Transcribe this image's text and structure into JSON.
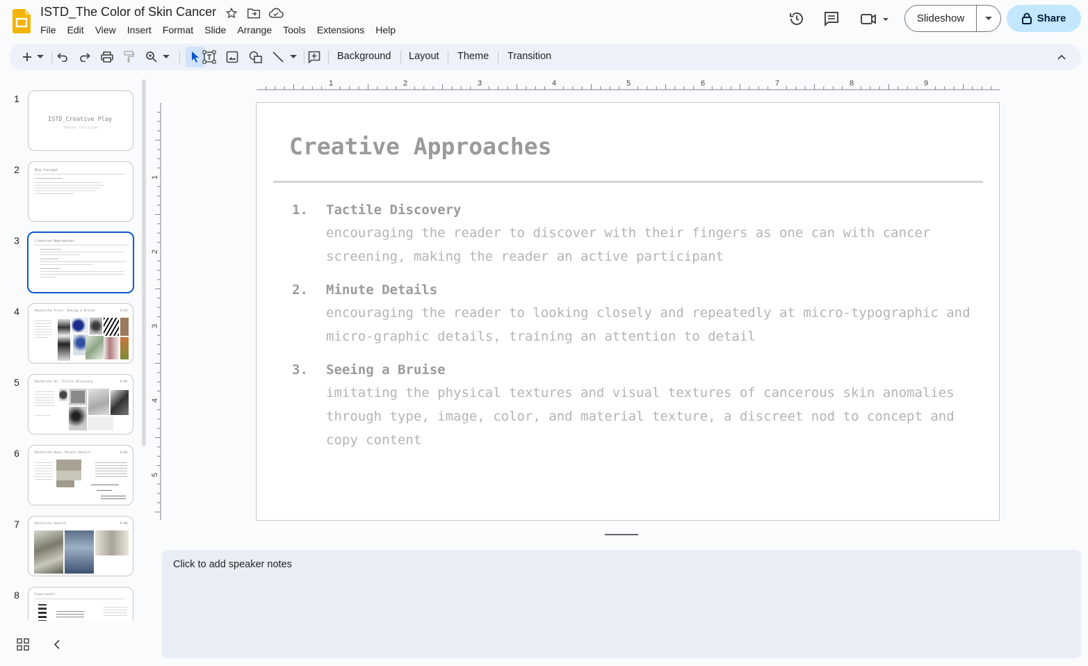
{
  "app": {
    "doc_title": "ISTD_The Color of Skin Cancer",
    "menu": [
      "File",
      "Edit",
      "View",
      "Insert",
      "Format",
      "Slide",
      "Arrange",
      "Tools",
      "Extensions",
      "Help"
    ],
    "slideshow_label": "Slideshow",
    "share_label": "Share",
    "accent_color": "#0b57d0",
    "share_bg": "#c2e7ff",
    "logo_color": "#f4b400"
  },
  "toolbar": {
    "background": "Background",
    "layout": "Layout",
    "theme": "Theme",
    "transition": "Transition"
  },
  "rulers": {
    "horizontal": [
      "1",
      "2",
      "3",
      "4",
      "5",
      "6",
      "7",
      "8",
      "9"
    ],
    "vertical": [
      "1",
      "2",
      "3",
      "4",
      "5"
    ]
  },
  "filmstrip": {
    "slides": [
      {
        "num": "1",
        "title": "ISTD_Creative Play",
        "subtitle": "Rachel Christian"
      },
      {
        "num": "2",
        "title": "Big Concept"
      },
      {
        "num": "3",
        "title": "Creative Approaches"
      },
      {
        "num": "4",
        "title": "Recherche Trois: Seeing a Bruise",
        "tag": "8–03"
      },
      {
        "num": "5",
        "title": "Recherche Un: Tactile Discovery",
        "tag": "8–05"
      },
      {
        "num": "6",
        "title": "Recherche Deux: Minute Details",
        "tag": "8–02"
      },
      {
        "num": "7",
        "title": "Recherche General",
        "tag": "8–00"
      },
      {
        "num": "8",
        "title": "Experiments"
      }
    ]
  },
  "slide": {
    "title": "Creative Approaches",
    "items": [
      {
        "num": "1.",
        "head": "Tactile Discovery",
        "body": "encouraging the reader to discover with their fingers as one can with cancer screening, making the reader an active participant"
      },
      {
        "num": "2.",
        "head": "Minute Details",
        "body": "encouraging the reader to looking closely and repeatedly at micro-typographic and micro-graphic details, training an attention to detail"
      },
      {
        "num": "3.",
        "head": "Seeing a Bruise",
        "body": "imitating the physical textures and visual textures of cancerous skin anomalies through type, image, color, and material texture, a discreet nod to concept and copy content"
      }
    ]
  },
  "notes": {
    "placeholder": "Click to add speaker notes"
  }
}
